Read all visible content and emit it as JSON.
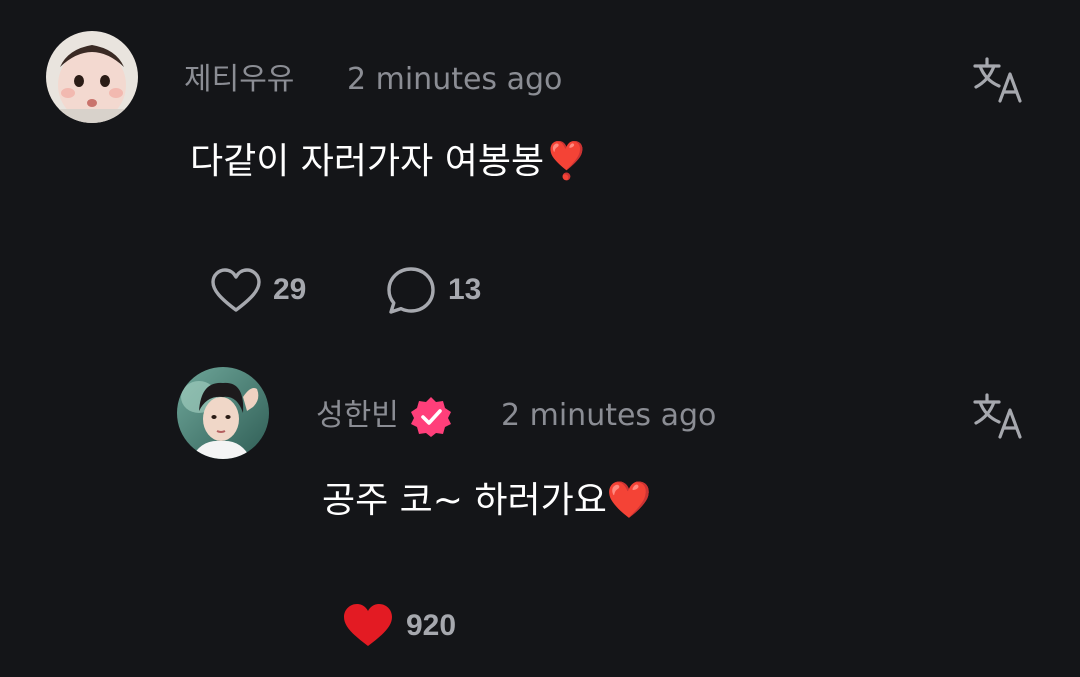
{
  "comments": [
    {
      "username": "제티우유",
      "timestamp": "2 minutes ago",
      "text": "다같이 자러가자 여봉봉",
      "emoji": "❣️",
      "like_count": "29",
      "reply_count": "13",
      "liked": false,
      "verified": false,
      "translate_icon": "translate-icon"
    },
    {
      "username": "성한빈",
      "timestamp": "2 minutes ago",
      "text": "공주 코~ 하러가요",
      "emoji": "❤️",
      "like_count": "920",
      "liked": true,
      "verified": true,
      "translate_icon": "translate-icon"
    }
  ],
  "colors": {
    "background": "#141518",
    "muted_text": "#8b8d94",
    "heart_red": "#e31b23",
    "verified_pink": "#ff3f7a"
  }
}
